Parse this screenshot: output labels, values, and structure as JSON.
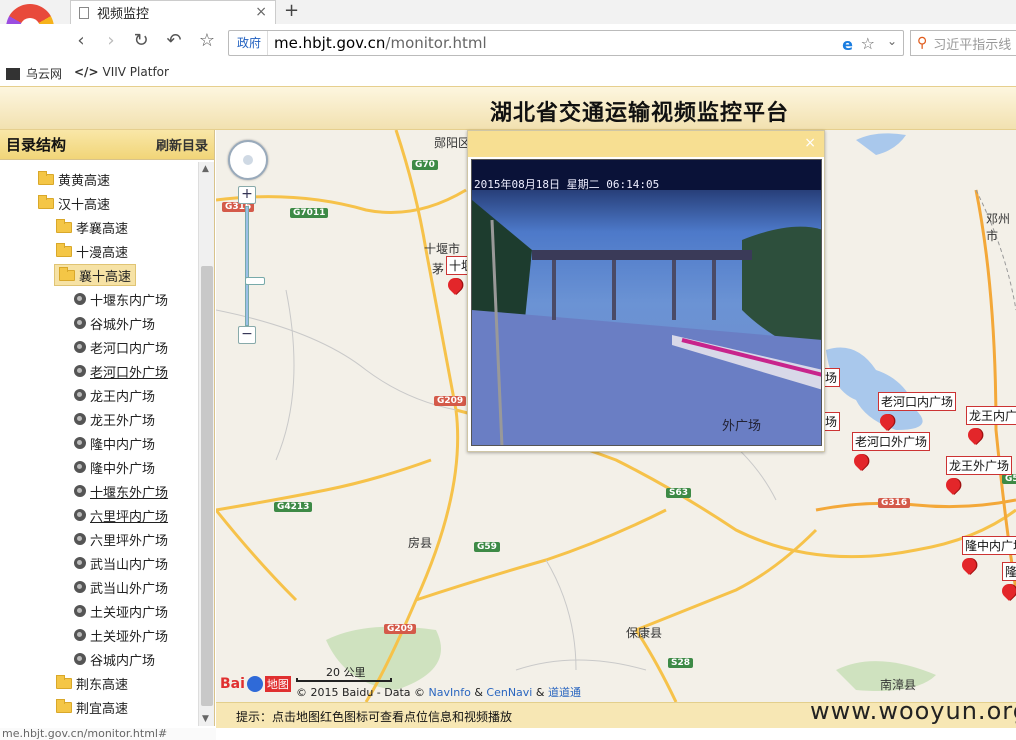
{
  "browser": {
    "tab_title": "视频监控",
    "address_prefix": "政府",
    "address_domain": "me.hbjt.gov.cn",
    "address_path": "/monitor.html",
    "search_placeholder": "习近平指示线",
    "bookmarks": [
      "乌云网",
      "VIIV Platfor"
    ]
  },
  "header": {
    "title": "湖北省交通运输视频监控平台"
  },
  "sidebar": {
    "title": "目录结构",
    "refresh": "刷新目录",
    "tree": [
      {
        "type": "folder",
        "label": "黄黄高速",
        "indent": 1
      },
      {
        "type": "folder",
        "label": "汉十高速",
        "indent": 1
      },
      {
        "type": "folder",
        "label": "孝襄高速",
        "indent": 2
      },
      {
        "type": "folder",
        "label": "十漫高速",
        "indent": 2
      },
      {
        "type": "folder",
        "label": "襄十高速",
        "indent": 2,
        "selected": true
      },
      {
        "type": "camera",
        "label": "十堰东内广场",
        "indent": 3
      },
      {
        "type": "camera",
        "label": "谷城外广场",
        "indent": 3
      },
      {
        "type": "camera",
        "label": "老河口内广场",
        "indent": 3
      },
      {
        "type": "camera",
        "label": "老河口外广场",
        "indent": 3,
        "underline": true
      },
      {
        "type": "camera",
        "label": "龙王内广场",
        "indent": 3
      },
      {
        "type": "camera",
        "label": "龙王外广场",
        "indent": 3
      },
      {
        "type": "camera",
        "label": "隆中内广场",
        "indent": 3
      },
      {
        "type": "camera",
        "label": "隆中外广场",
        "indent": 3
      },
      {
        "type": "camera",
        "label": "十堰东外广场",
        "indent": 3,
        "underline": true
      },
      {
        "type": "camera",
        "label": "六里坪内广场",
        "indent": 3,
        "underline": true
      },
      {
        "type": "camera",
        "label": "六里坪外广场",
        "indent": 3
      },
      {
        "type": "camera",
        "label": "武当山内广场",
        "indent": 3
      },
      {
        "type": "camera",
        "label": "武当山外广场",
        "indent": 3
      },
      {
        "type": "camera",
        "label": "土关垭内广场",
        "indent": 3
      },
      {
        "type": "camera",
        "label": "土关垭外广场",
        "indent": 3
      },
      {
        "type": "camera",
        "label": "谷城内广场",
        "indent": 3
      },
      {
        "type": "folder",
        "label": "荆东高速",
        "indent": 2
      },
      {
        "type": "folder",
        "label": "荆宜高速",
        "indent": 2
      }
    ]
  },
  "map": {
    "places": [
      "郧阳区",
      "十堰市",
      "房县",
      "保康县",
      "南漳县",
      "邓州市",
      "茅"
    ],
    "highways": [
      "G70",
      "G316",
      "G7011",
      "G209",
      "G4213",
      "S63",
      "G59",
      "G209",
      "S28",
      "G316",
      "G5"
    ],
    "marker_labels": [
      "十堰",
      "场",
      "场",
      "老河口内广场",
      "龙王内广",
      "老河口外广场",
      "龙王外广场",
      "隆中内广场",
      "隆"
    ],
    "scale": "20 公里",
    "baidu_brand": "Bai",
    "baidu_map": "地图",
    "copyright": "© 2015 Baidu - Data ©",
    "navinfo": "NavInfo",
    "amp": "&",
    "cennavi": "CenNavi",
    "daodao": "道道通"
  },
  "popup": {
    "osd": "2015年08月18日 星期二 06:14:05",
    "caption": "外广场",
    "close": "×"
  },
  "footer": {
    "tip": "提示：点击地图红色图标可查看点位信息和视频播放",
    "watermark": "www.wooyun.org"
  },
  "status_bar": "me.hbjt.gov.cn/monitor.html#"
}
